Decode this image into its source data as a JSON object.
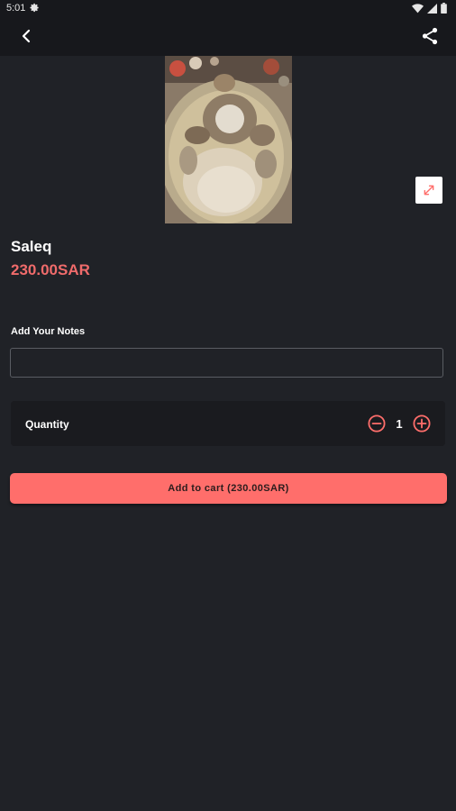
{
  "status_bar": {
    "time": "5:01"
  },
  "app_bar": {
    "back_icon": "arrow-back-icon",
    "share_icon": "share-icon"
  },
  "product": {
    "image_subject": "Saleq dish photo",
    "name": "Saleq",
    "price": "230.00SAR"
  },
  "notes": {
    "label": "Add Your Notes",
    "value": "",
    "placeholder": ""
  },
  "quantity": {
    "label": "Quantity",
    "value": "1"
  },
  "cart": {
    "button_label": "Add to cart (230.00SAR)"
  },
  "colors": {
    "background": "#202227",
    "accent": "#ff6e6b",
    "price": "#f06b6b"
  }
}
